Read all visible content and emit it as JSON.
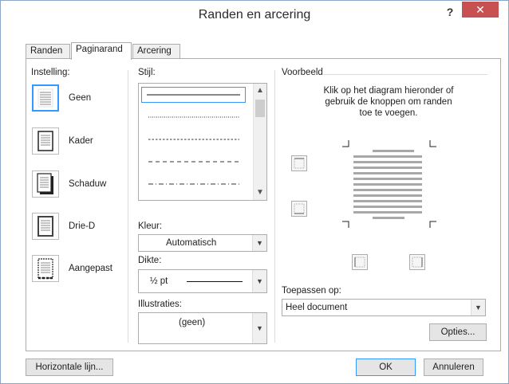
{
  "window": {
    "title": "Randen en arcering",
    "help": "?",
    "close": "✕"
  },
  "tabs": [
    {
      "label": "Randen",
      "underline_index": 2
    },
    {
      "label": "Paginarand",
      "underline_index": 0
    },
    {
      "label": "Arcering",
      "underline_index": 2
    }
  ],
  "instelling": {
    "label": "Instelling:",
    "items": [
      {
        "label": "Geen"
      },
      {
        "label": "Kader"
      },
      {
        "label": "Schaduw"
      },
      {
        "label": "Drie-D"
      },
      {
        "label": "Aangepast"
      }
    ]
  },
  "stijl": {
    "label": "Stijl:"
  },
  "kleur": {
    "label": "Kleur:",
    "value": "Automatisch"
  },
  "dikte": {
    "label": "Dikte:",
    "value": "½ pt"
  },
  "illustraties": {
    "label": "Illustraties:",
    "value": "(geen)"
  },
  "voorbeeld": {
    "label": "Voorbeeld",
    "instructions_line1": "Klik op het diagram hieronder of",
    "instructions_line2": "gebruik de knoppen om randen",
    "instructions_line3": "toe te voegen."
  },
  "toepassen": {
    "label": "Toepassen op:",
    "value": "Heel document"
  },
  "buttons": {
    "opties": "Opties...",
    "horizontale_lijn": "Horizontale lijn...",
    "ok": "OK",
    "annuleren": "Annuleren"
  },
  "colors": {
    "accent": "#3399ff",
    "close_bg": "#c75050"
  }
}
